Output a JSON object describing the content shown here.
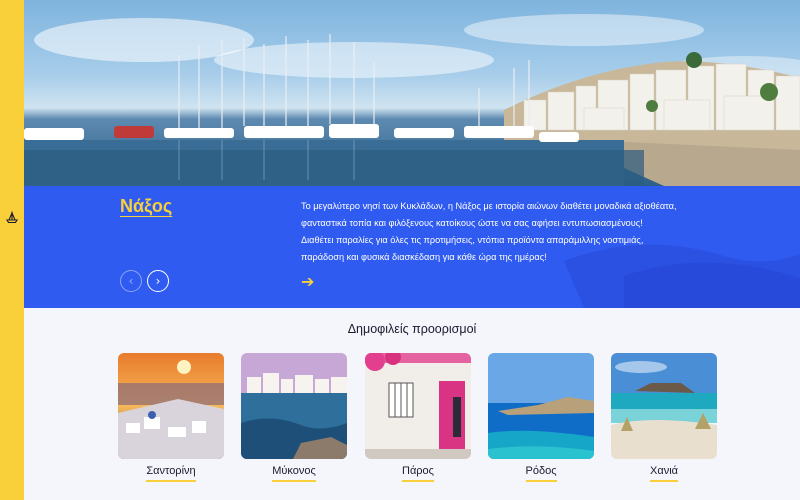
{
  "sidebar": {
    "icon": "anchor-icon",
    "arrow": "›"
  },
  "hero": {
    "image": "naxos-harbor-photo"
  },
  "featured": {
    "title": "Νάξος",
    "description_lines": [
      "Το μεγαλύτερο νησί των Κυκλάδων, η Νάξος με ιστορία αιώνων διαθέτει μοναδικά αξιοθέατα,",
      "φανταστικά τοπία και φιλόξενους κατοίκους ώστε να σας αφήσει εντυπωσιασμένους!",
      "Διαθέτει παραλίες για όλες τις προτιμήσεις, ντόπια προϊόντα απαράμιλλης νοστιμιάς,",
      "παράδοση και φυσικά διασκέδαση για κάθε ώρα της ημέρας!"
    ],
    "read_more_icon": "➔",
    "prev_icon": "‹",
    "next_icon": "›"
  },
  "popular": {
    "title": "Δημοφιλείς προορισμοί",
    "items": [
      {
        "label": "Σαντορίνη"
      },
      {
        "label": "Μύκονος"
      },
      {
        "label": "Πάρος"
      },
      {
        "label": "Ρόδος"
      },
      {
        "label": "Χανιά"
      }
    ]
  },
  "colors": {
    "accent": "#f9d03a",
    "brand_blue": "#2f5bf1"
  }
}
